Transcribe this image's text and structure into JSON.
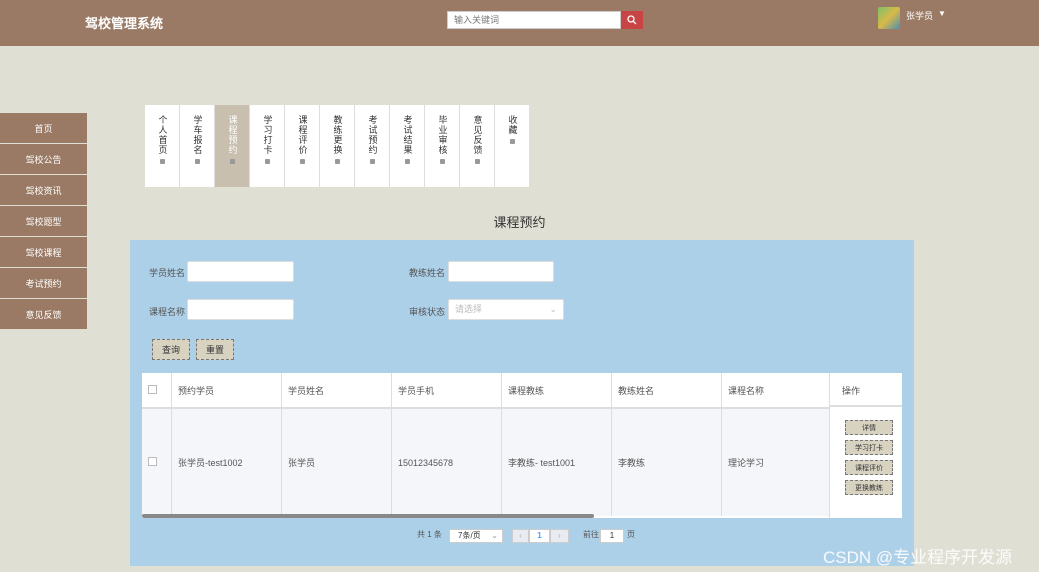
{
  "app": {
    "title": "驾校管理系统"
  },
  "header": {
    "search_placeholder": "输入关键词",
    "user_name": "张学员"
  },
  "sidebar": {
    "items": [
      {
        "label": "首页"
      },
      {
        "label": "驾校公告"
      },
      {
        "label": "驾校资讯"
      },
      {
        "label": "驾校题型"
      },
      {
        "label": "驾校课程"
      },
      {
        "label": "考试预约"
      },
      {
        "label": "意见反馈"
      }
    ]
  },
  "tabs": [
    {
      "label": "个人首页",
      "active": false
    },
    {
      "label": "学车报名",
      "active": false
    },
    {
      "label": "课程预约",
      "active": true
    },
    {
      "label": "学习打卡",
      "active": false
    },
    {
      "label": "课程评价",
      "active": false
    },
    {
      "label": "教练更换",
      "active": false
    },
    {
      "label": "考试预约",
      "active": false
    },
    {
      "label": "考试结果",
      "active": false
    },
    {
      "label": "毕业审核",
      "active": false
    },
    {
      "label": "意见反馈",
      "active": false
    },
    {
      "label": "收藏",
      "active": false
    }
  ],
  "page": {
    "heading": "课程预约"
  },
  "filters": {
    "student_name_label": "学员姓名",
    "coach_name_label": "教练姓名",
    "course_name_label": "课程名称",
    "review_status_label": "审核状态",
    "review_status_placeholder": "请选择",
    "query_button": "查询",
    "reset_button": "重置"
  },
  "table": {
    "columns": [
      "预约学员",
      "学员姓名",
      "学员手机",
      "课程教练",
      "教练姓名",
      "课程名称"
    ],
    "ops_header": "操作",
    "rows": [
      {
        "cells": [
          "张学员-test1002",
          "张学员",
          "15012345678",
          "李教练- test1001",
          "李教练",
          "理论学习"
        ],
        "actions": [
          "详情",
          "学习打卡",
          "课程评价",
          "更换教练"
        ]
      }
    ]
  },
  "pagination": {
    "total_text": "共 1 条",
    "page_size": "7条/页",
    "current_page": "1",
    "goto_label": "前往",
    "goto_value": "1",
    "page_suffix": "页"
  },
  "watermark": "CSDN @专业程序开发源"
}
